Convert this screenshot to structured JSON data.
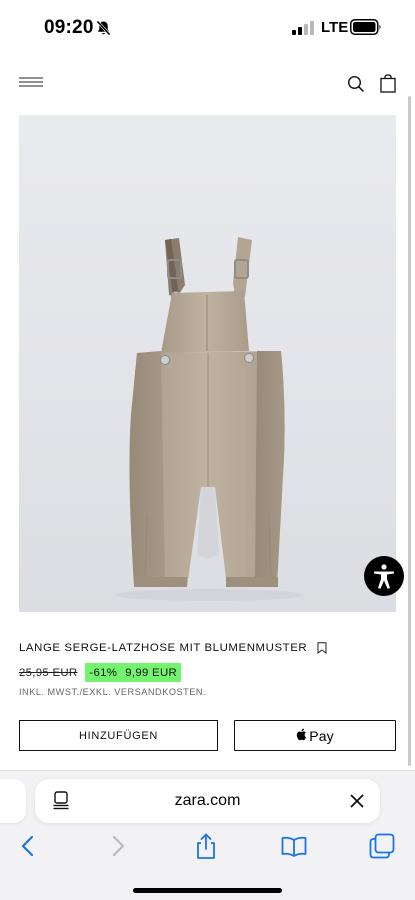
{
  "status_bar": {
    "time": "09:20",
    "network": "LTE",
    "icons": [
      "bell-off-icon",
      "signal-icon",
      "battery-icon"
    ]
  },
  "top_nav": {
    "icons": [
      "menu-icon",
      "search-icon",
      "shopping-bag-icon"
    ]
  },
  "product": {
    "title": "LANGE SERGE-LATZHOSE MIT BLUMENMUSTER",
    "old_price": "25,95 EUR",
    "discount": "-61%",
    "sale_price": "9,99 EUR",
    "tax_note": "INKL. MWST./EXKL. VERSANDKOSTEN.",
    "image_icon": "overall-product-photo",
    "bookmark_icon": "bookmark-icon"
  },
  "actions": {
    "add_label": "HINZUFÜGEN",
    "apple_pay_label": "Pay"
  },
  "browser": {
    "url": "zara.com",
    "toolbar_icons": [
      "back-icon",
      "forward-icon",
      "share-icon",
      "bookmarks-icon",
      "tabs-icon"
    ]
  },
  "colors": {
    "sale_badge": "#74f36e",
    "accent_blue": "#1a73e8"
  }
}
